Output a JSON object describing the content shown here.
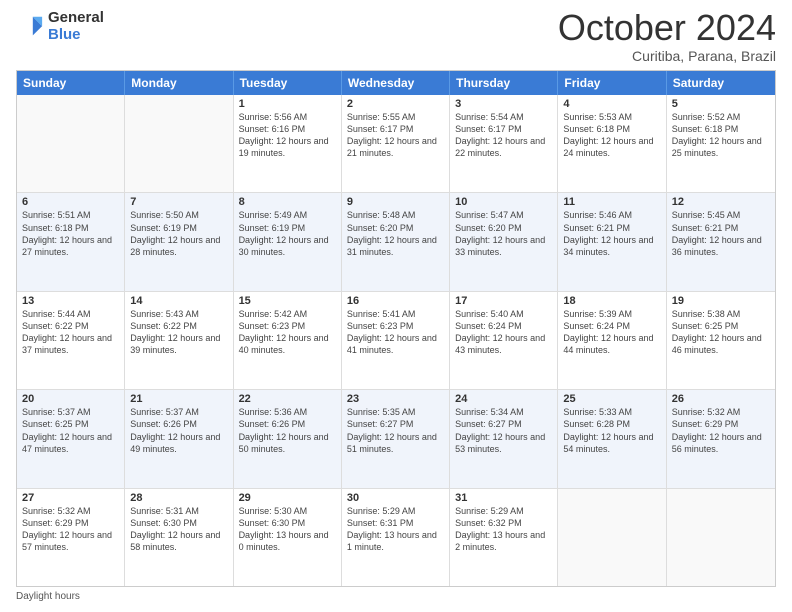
{
  "logo": {
    "line1": "General",
    "line2": "Blue"
  },
  "title": "October 2024",
  "location": "Curitiba, Parana, Brazil",
  "days_of_week": [
    "Sunday",
    "Monday",
    "Tuesday",
    "Wednesday",
    "Thursday",
    "Friday",
    "Saturday"
  ],
  "footer": "Daylight hours",
  "weeks": [
    [
      {
        "day": "",
        "sunrise": "",
        "sunset": "",
        "daylight": "",
        "alt": false
      },
      {
        "day": "",
        "sunrise": "",
        "sunset": "",
        "daylight": "",
        "alt": false
      },
      {
        "day": "1",
        "sunrise": "Sunrise: 5:56 AM",
        "sunset": "Sunset: 6:16 PM",
        "daylight": "Daylight: 12 hours and 19 minutes.",
        "alt": false
      },
      {
        "day": "2",
        "sunrise": "Sunrise: 5:55 AM",
        "sunset": "Sunset: 6:17 PM",
        "daylight": "Daylight: 12 hours and 21 minutes.",
        "alt": false
      },
      {
        "day": "3",
        "sunrise": "Sunrise: 5:54 AM",
        "sunset": "Sunset: 6:17 PM",
        "daylight": "Daylight: 12 hours and 22 minutes.",
        "alt": false
      },
      {
        "day": "4",
        "sunrise": "Sunrise: 5:53 AM",
        "sunset": "Sunset: 6:18 PM",
        "daylight": "Daylight: 12 hours and 24 minutes.",
        "alt": false
      },
      {
        "day": "5",
        "sunrise": "Sunrise: 5:52 AM",
        "sunset": "Sunset: 6:18 PM",
        "daylight": "Daylight: 12 hours and 25 minutes.",
        "alt": false
      }
    ],
    [
      {
        "day": "6",
        "sunrise": "Sunrise: 5:51 AM",
        "sunset": "Sunset: 6:18 PM",
        "daylight": "Daylight: 12 hours and 27 minutes.",
        "alt": true
      },
      {
        "day": "7",
        "sunrise": "Sunrise: 5:50 AM",
        "sunset": "Sunset: 6:19 PM",
        "daylight": "Daylight: 12 hours and 28 minutes.",
        "alt": true
      },
      {
        "day": "8",
        "sunrise": "Sunrise: 5:49 AM",
        "sunset": "Sunset: 6:19 PM",
        "daylight": "Daylight: 12 hours and 30 minutes.",
        "alt": true
      },
      {
        "day": "9",
        "sunrise": "Sunrise: 5:48 AM",
        "sunset": "Sunset: 6:20 PM",
        "daylight": "Daylight: 12 hours and 31 minutes.",
        "alt": true
      },
      {
        "day": "10",
        "sunrise": "Sunrise: 5:47 AM",
        "sunset": "Sunset: 6:20 PM",
        "daylight": "Daylight: 12 hours and 33 minutes.",
        "alt": true
      },
      {
        "day": "11",
        "sunrise": "Sunrise: 5:46 AM",
        "sunset": "Sunset: 6:21 PM",
        "daylight": "Daylight: 12 hours and 34 minutes.",
        "alt": true
      },
      {
        "day": "12",
        "sunrise": "Sunrise: 5:45 AM",
        "sunset": "Sunset: 6:21 PM",
        "daylight": "Daylight: 12 hours and 36 minutes.",
        "alt": true
      }
    ],
    [
      {
        "day": "13",
        "sunrise": "Sunrise: 5:44 AM",
        "sunset": "Sunset: 6:22 PM",
        "daylight": "Daylight: 12 hours and 37 minutes.",
        "alt": false
      },
      {
        "day": "14",
        "sunrise": "Sunrise: 5:43 AM",
        "sunset": "Sunset: 6:22 PM",
        "daylight": "Daylight: 12 hours and 39 minutes.",
        "alt": false
      },
      {
        "day": "15",
        "sunrise": "Sunrise: 5:42 AM",
        "sunset": "Sunset: 6:23 PM",
        "daylight": "Daylight: 12 hours and 40 minutes.",
        "alt": false
      },
      {
        "day": "16",
        "sunrise": "Sunrise: 5:41 AM",
        "sunset": "Sunset: 6:23 PM",
        "daylight": "Daylight: 12 hours and 41 minutes.",
        "alt": false
      },
      {
        "day": "17",
        "sunrise": "Sunrise: 5:40 AM",
        "sunset": "Sunset: 6:24 PM",
        "daylight": "Daylight: 12 hours and 43 minutes.",
        "alt": false
      },
      {
        "day": "18",
        "sunrise": "Sunrise: 5:39 AM",
        "sunset": "Sunset: 6:24 PM",
        "daylight": "Daylight: 12 hours and 44 minutes.",
        "alt": false
      },
      {
        "day": "19",
        "sunrise": "Sunrise: 5:38 AM",
        "sunset": "Sunset: 6:25 PM",
        "daylight": "Daylight: 12 hours and 46 minutes.",
        "alt": false
      }
    ],
    [
      {
        "day": "20",
        "sunrise": "Sunrise: 5:37 AM",
        "sunset": "Sunset: 6:25 PM",
        "daylight": "Daylight: 12 hours and 47 minutes.",
        "alt": true
      },
      {
        "day": "21",
        "sunrise": "Sunrise: 5:37 AM",
        "sunset": "Sunset: 6:26 PM",
        "daylight": "Daylight: 12 hours and 49 minutes.",
        "alt": true
      },
      {
        "day": "22",
        "sunrise": "Sunrise: 5:36 AM",
        "sunset": "Sunset: 6:26 PM",
        "daylight": "Daylight: 12 hours and 50 minutes.",
        "alt": true
      },
      {
        "day": "23",
        "sunrise": "Sunrise: 5:35 AM",
        "sunset": "Sunset: 6:27 PM",
        "daylight": "Daylight: 12 hours and 51 minutes.",
        "alt": true
      },
      {
        "day": "24",
        "sunrise": "Sunrise: 5:34 AM",
        "sunset": "Sunset: 6:27 PM",
        "daylight": "Daylight: 12 hours and 53 minutes.",
        "alt": true
      },
      {
        "day": "25",
        "sunrise": "Sunrise: 5:33 AM",
        "sunset": "Sunset: 6:28 PM",
        "daylight": "Daylight: 12 hours and 54 minutes.",
        "alt": true
      },
      {
        "day": "26",
        "sunrise": "Sunrise: 5:32 AM",
        "sunset": "Sunset: 6:29 PM",
        "daylight": "Daylight: 12 hours and 56 minutes.",
        "alt": true
      }
    ],
    [
      {
        "day": "27",
        "sunrise": "Sunrise: 5:32 AM",
        "sunset": "Sunset: 6:29 PM",
        "daylight": "Daylight: 12 hours and 57 minutes.",
        "alt": false
      },
      {
        "day": "28",
        "sunrise": "Sunrise: 5:31 AM",
        "sunset": "Sunset: 6:30 PM",
        "daylight": "Daylight: 12 hours and 58 minutes.",
        "alt": false
      },
      {
        "day": "29",
        "sunrise": "Sunrise: 5:30 AM",
        "sunset": "Sunset: 6:30 PM",
        "daylight": "Daylight: 13 hours and 0 minutes.",
        "alt": false
      },
      {
        "day": "30",
        "sunrise": "Sunrise: 5:29 AM",
        "sunset": "Sunset: 6:31 PM",
        "daylight": "Daylight: 13 hours and 1 minute.",
        "alt": false
      },
      {
        "day": "31",
        "sunrise": "Sunrise: 5:29 AM",
        "sunset": "Sunset: 6:32 PM",
        "daylight": "Daylight: 13 hours and 2 minutes.",
        "alt": false
      },
      {
        "day": "",
        "sunrise": "",
        "sunset": "",
        "daylight": "",
        "alt": false
      },
      {
        "day": "",
        "sunrise": "",
        "sunset": "",
        "daylight": "",
        "alt": false
      }
    ]
  ]
}
